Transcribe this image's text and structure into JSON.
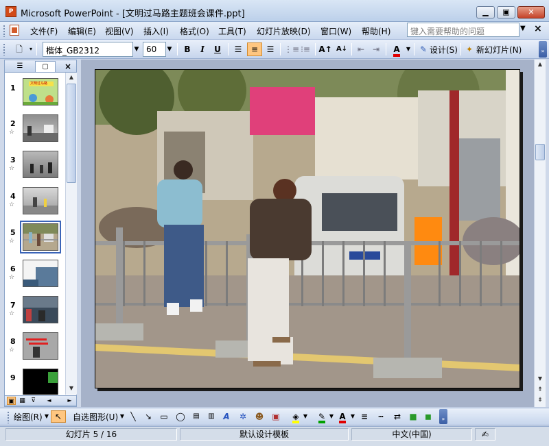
{
  "window": {
    "title": "Microsoft PowerPoint - [文明过马路主题班会课件.ppt]",
    "app_icon_letter": "P",
    "minimize_icon": "minimize-icon",
    "maximize_icon": "maximize-icon",
    "close_icon": "close-icon"
  },
  "menu": {
    "items": [
      "文件(F)",
      "编辑(E)",
      "视图(V)",
      "插入(I)",
      "格式(O)",
      "工具(T)",
      "幻灯片放映(D)",
      "窗口(W)",
      "帮助(H)"
    ],
    "help_placeholder": "键入需要帮助的问题"
  },
  "toolbar": {
    "font_name": "楷体_GB2312",
    "font_size": "60",
    "bold": "B",
    "italic": "I",
    "underline": "U",
    "design_label": "设计(S)",
    "new_slide_label": "新幻灯片(N)"
  },
  "slides_pane": {
    "slides": [
      {
        "num": "1",
        "has_star": false
      },
      {
        "num": "2",
        "has_star": true
      },
      {
        "num": "3",
        "has_star": true
      },
      {
        "num": "4",
        "has_star": true
      },
      {
        "num": "5",
        "has_star": true,
        "selected": true
      },
      {
        "num": "6",
        "has_star": true
      },
      {
        "num": "7",
        "has_star": true
      },
      {
        "num": "8",
        "has_star": true
      },
      {
        "num": "9",
        "has_star": false
      }
    ],
    "star_glyph": "☆",
    "thumb1_text": "文明过马路"
  },
  "drawing_toolbar": {
    "draw_label": "绘图(R)",
    "autoshapes_label": "自选图形(U)"
  },
  "status": {
    "slide_info": "幻灯片 5 / 16",
    "template": "默认设计模板",
    "language": "中文(中国)"
  },
  "colors": {
    "accent": "#3a64b8",
    "pressed": "#ffc680",
    "font_color_swatch": "#e00000",
    "fill_color_swatch": "#ffff00",
    "line_color_swatch": "#00a000"
  }
}
